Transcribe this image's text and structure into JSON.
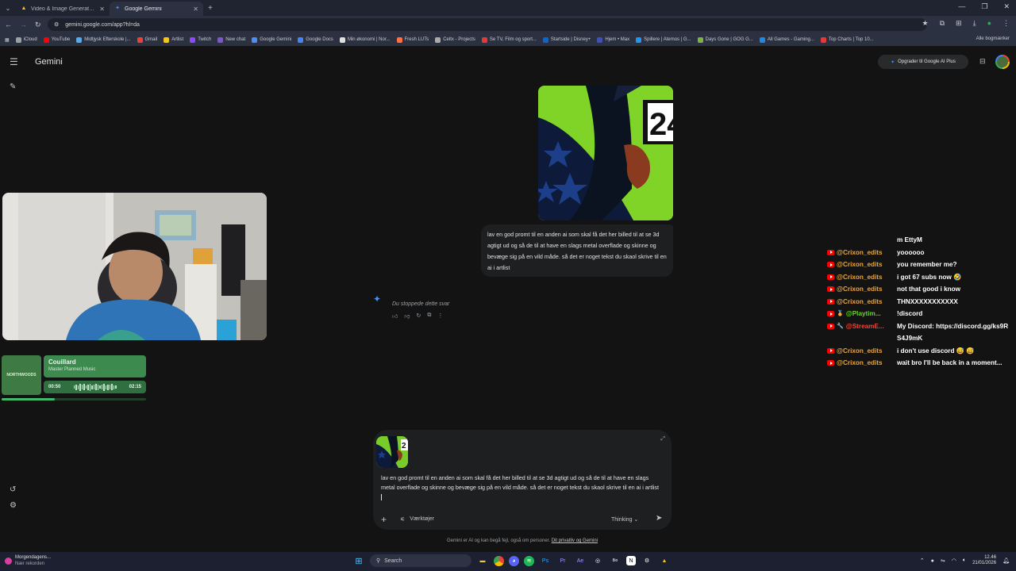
{
  "browser": {
    "tabs": [
      {
        "title": "Video & Image Generation – AI",
        "active": false
      },
      {
        "title": "Google Gemini",
        "active": true
      }
    ],
    "url": "gemini.google.com/app?hl=da",
    "bookmarks": [
      "iCloud",
      "YouTube",
      "Midtjysk Efterskole |...",
      "Gmail",
      "Artlist",
      "Twitch",
      "New chat",
      "Google Gemini",
      "Google Docs",
      "Min økonomi | Nor...",
      "Fresh LUTs",
      "Celtx - Projects",
      "Se TV, Film og sport...",
      "Startside | Disney+",
      "Hjem • Max",
      "Spillere | Atemos | G...",
      "Days Gone | GOG G...",
      "All Games - Gaming...",
      "Top Charts | Top 10..."
    ],
    "bookmarks_all": "Alle bogmærker"
  },
  "gemini": {
    "brand": "Gemini",
    "upgrade_label": "Opgrader til Google AI Plus",
    "user_prompt": "lav en god promt til en anden ai som skal få det her billed til at se 3d agtigt ud og så de til at have en slags metal overflade og skinne og bevæge sig på en vild måde. så det er noget tekst du skaol skrive til en ai i artlist",
    "response_status": "Du stoppede dette svar",
    "input_text": "lav en god promt til en anden ai som skal få det her billed til at se 3d agtigt ud og så de til at have en slags metal overflade og skinne og bevæge sig på en vild måde. så det er noget tekst du skaol skrive til en ai i artlist",
    "tools_label": "Værktøjer",
    "model_label": "Thinking",
    "disclaimer": "Gemini er AI og kan begå fejl, også om personer.",
    "disclaimer_link": "Dit privatliv og Gemini",
    "image_number": "24"
  },
  "music": {
    "album_text": "NORTHWOODS",
    "title": "Couillard",
    "artist": "Master Planned Music",
    "elapsed": "00:50",
    "duration": "02:15",
    "progress": 0.37
  },
  "chat": [
    {
      "user": "",
      "text": "m EttyM",
      "platform": "",
      "color": "#ffffff"
    },
    {
      "user": "@Crixon_edits",
      "text": "yoooooo",
      "platform": "youtube",
      "color": "#e9a53c"
    },
    {
      "user": "@Crixon_edits",
      "text": "you remember me?",
      "platform": "youtube",
      "color": "#e9a53c"
    },
    {
      "user": "@Crixon_edits",
      "text": "i got 67 subs now 🤣",
      "platform": "youtube",
      "color": "#e9a53c"
    },
    {
      "user": "@Crixon_edits",
      "text": "not that good i know",
      "platform": "youtube",
      "color": "#e9a53c"
    },
    {
      "user": "@Crixon_edits",
      "text": "THNXXXXXXXXXXX",
      "platform": "youtube",
      "color": "#e9a53c"
    },
    {
      "user": "@Playtim...",
      "text": "!discord",
      "platform": "youtube",
      "color": "#6ccf2f",
      "badge": "🏅"
    },
    {
      "user": "@StreamE...",
      "text": "My Discord: https://discord.gg/ks9RS4J9mK",
      "platform": "youtube",
      "color": "#e8483b",
      "badge": "🔧"
    },
    {
      "user": "@Crixon_edits",
      "text": "i don't use discord 😅 😅",
      "platform": "youtube",
      "color": "#e9a53c"
    },
    {
      "user": "@Crixon_edits",
      "text": "wait bro I'll be back in a moment...",
      "platform": "youtube",
      "color": "#e9a53c"
    }
  ],
  "taskbar": {
    "weather_title": "Morgendagens...",
    "weather_sub": "Nær rekorden",
    "search_label": "Search",
    "time": "12.46",
    "date": "21/01/2026"
  }
}
